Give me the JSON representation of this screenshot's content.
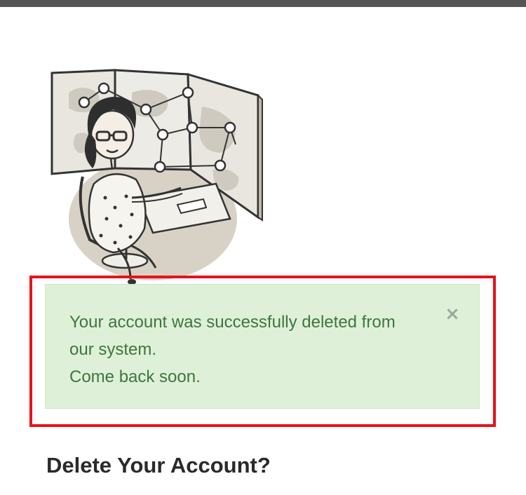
{
  "alert": {
    "message": "Your account was successfully deleted from\nour system.\nCome back soon.",
    "close_glyph": "×",
    "background_color": "#dff0d8",
    "text_color": "#3c763d",
    "highlight_color": "#e8121b"
  },
  "page": {
    "title": "Delete Your Account?"
  },
  "illustration": {
    "subject": "woman-at-world-map-network-screen-illustration"
  }
}
